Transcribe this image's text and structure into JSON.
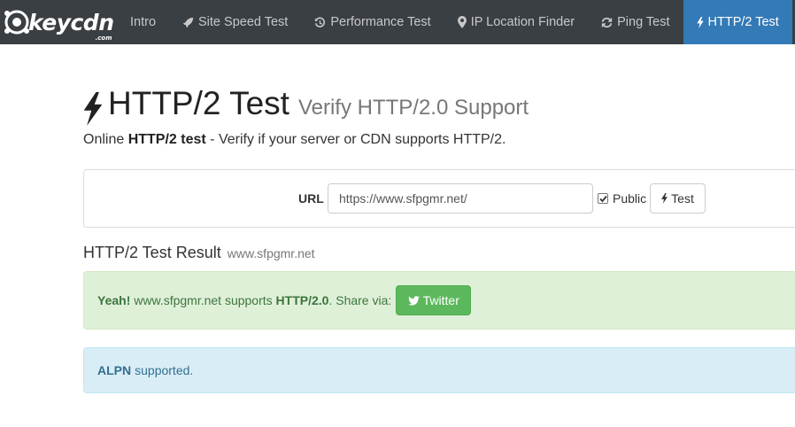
{
  "navbar": {
    "brand": "keycdn",
    "brand_sub": ".com",
    "items": [
      {
        "label": "Intro",
        "icon": ""
      },
      {
        "label": "Site Speed Test",
        "icon": "rocket-icon"
      },
      {
        "label": "Performance Test",
        "icon": "history-icon"
      },
      {
        "label": "IP Location Finder",
        "icon": "map-marker-icon"
      },
      {
        "label": "Ping Test",
        "icon": "refresh-icon"
      },
      {
        "label": "HTTP/2 Test",
        "icon": "bolt-icon",
        "active": true
      }
    ],
    "active_color": "#337ab7",
    "background": "#3a3f44"
  },
  "page": {
    "title": "HTTP/2 Test",
    "subtitle": "Verify HTTP/2.0 Support",
    "lead_prefix": "Online ",
    "lead_bold": "HTTP/2 test",
    "lead_suffix": " - Verify if your server or CDN supports HTTP/2."
  },
  "form": {
    "url_label": "URL",
    "url_value": "https://www.sfpgmr.net/",
    "public_label": "Public",
    "public_checked": true,
    "test_button": "Test"
  },
  "result": {
    "heading": "HTTP/2 Test Result",
    "host": "www.sfpgmr.net",
    "success_bold": "Yeah!",
    "success_text": " www.sfpgmr.net supports ",
    "success_protocol": "HTTP/2.0",
    "success_share": ". Share via:",
    "twitter_button": "Twitter",
    "success_color": "#dff0d8",
    "alpn_bold": "ALPN",
    "alpn_text": "supported.",
    "info_color": "#d9edf7"
  }
}
